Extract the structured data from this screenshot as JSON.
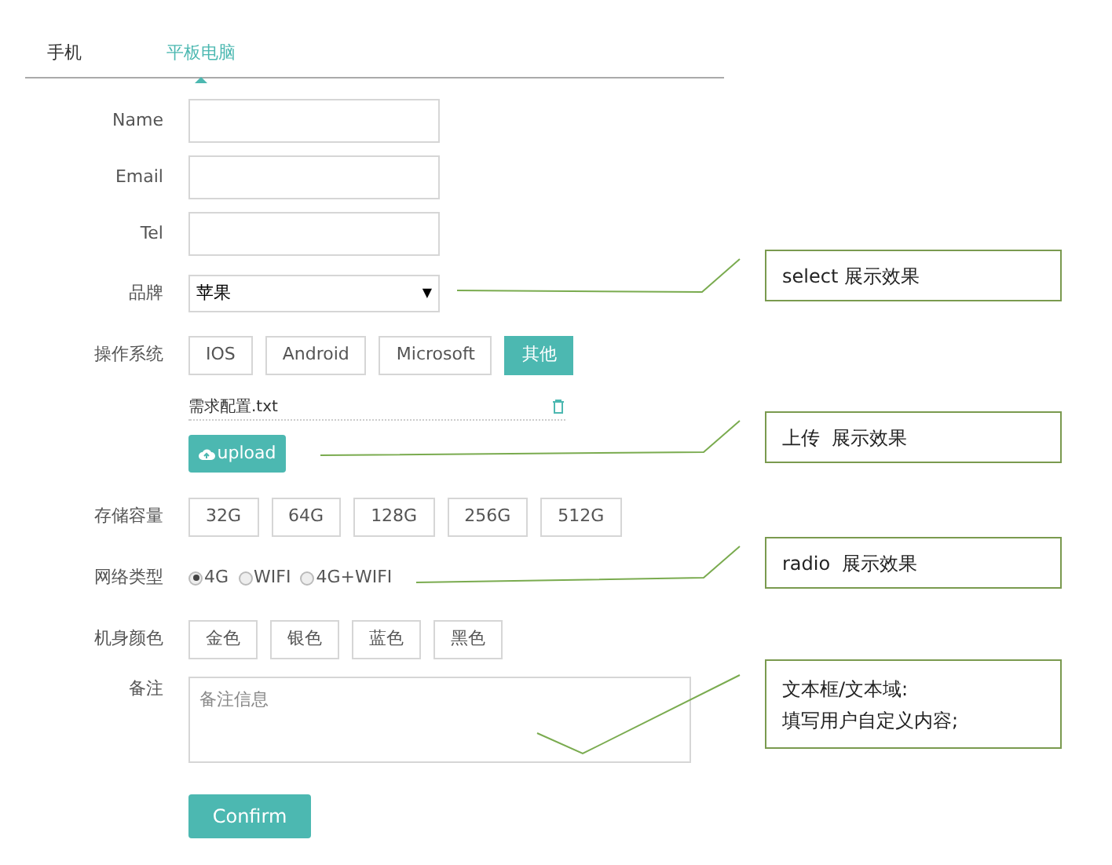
{
  "tabs": [
    {
      "label": "手机",
      "selected": false
    },
    {
      "label": "平板电脑",
      "selected": true
    }
  ],
  "form": {
    "name": {
      "label": "Name"
    },
    "email": {
      "label": "Email"
    },
    "tel": {
      "label": "Tel"
    },
    "brand": {
      "label": "品牌",
      "value": "苹果",
      "arrow": "▼"
    },
    "os": {
      "label": "操作系统",
      "options": [
        {
          "label": "IOS",
          "selected": false
        },
        {
          "label": "Android",
          "selected": false
        },
        {
          "label": "Microsoft",
          "selected": false
        },
        {
          "label": "其他",
          "selected": true
        }
      ]
    },
    "file": {
      "name": "需求配置.txt"
    },
    "upload": {
      "label": "upload"
    },
    "storage": {
      "label": "存储容量",
      "options": [
        {
          "label": "32G",
          "selected": false
        },
        {
          "label": "64G",
          "selected": false
        },
        {
          "label": "128G",
          "selected": false
        },
        {
          "label": "256G",
          "selected": false
        },
        {
          "label": "512G",
          "selected": false
        }
      ]
    },
    "network": {
      "label": "网络类型",
      "options": [
        {
          "label": "4G",
          "selected": true
        },
        {
          "label": "WIFI",
          "selected": false
        },
        {
          "label": "4G+WIFI",
          "selected": false
        }
      ]
    },
    "color": {
      "label": "机身颜色",
      "options": [
        {
          "label": "金色",
          "selected": false
        },
        {
          "label": "银色",
          "selected": false
        },
        {
          "label": "蓝色",
          "selected": false
        },
        {
          "label": "黑色",
          "selected": false
        }
      ]
    },
    "remark": {
      "label": "备注",
      "placeholder": "备注信息"
    },
    "confirm": "Confirm"
  },
  "notes": [
    {
      "lines": [
        "select 展示效果"
      ]
    },
    {
      "lines": [
        "上传  展示效果"
      ]
    },
    {
      "lines": [
        "radio  展示效果"
      ]
    },
    {
      "lines": [
        "文本框/文本域:",
        "填写用户自定义内容;"
      ]
    }
  ]
}
